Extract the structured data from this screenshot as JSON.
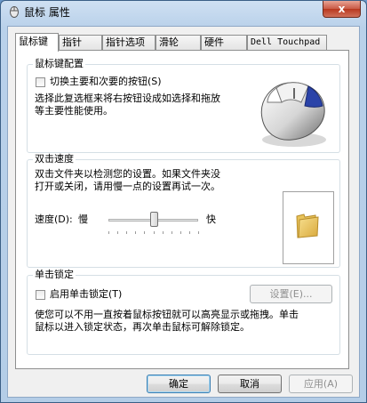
{
  "window": {
    "title": "鼠标 属性",
    "close_label": "x"
  },
  "tabs": [
    {
      "label": "鼠标键"
    },
    {
      "label": "指针"
    },
    {
      "label": "指针选项"
    },
    {
      "label": "滑轮"
    },
    {
      "label": "硬件"
    },
    {
      "label": "Dell Touchpad"
    }
  ],
  "button_config": {
    "group_label": "鼠标键配置",
    "checkbox_label": "切换主要和次要的按钮(S)",
    "checked": false,
    "description_line1": "选择此复选框来将右按钮设成如选择和拖放",
    "description_line2": "等主要性能使用。"
  },
  "double_click": {
    "group_label": "双击速度",
    "description_line1": "双击文件夹以检测您的设置。如果文件夹没",
    "description_line2": "打开或关闭，请用慢一点的设置再试一次。",
    "speed_label": "速度(D):",
    "slow_label": "慢",
    "fast_label": "快",
    "speed_level": 0.5
  },
  "click_lock": {
    "group_label": "单击锁定",
    "checkbox_label": "启用单击锁定(T)",
    "checked": false,
    "settings_button": "设置(E)...",
    "description_line1": "使您可以不用一直按着鼠标按钮就可以高亮显示或拖拽。单击",
    "description_line2": "鼠标以进入锁定状态，再次单击鼠标可解除锁定。"
  },
  "footer": {
    "ok_label": "确定",
    "cancel_label": "取消",
    "apply_label": "应用(A)"
  },
  "icons": [
    "mouse-properties-icon",
    "mouse-image-icon",
    "folder-icon"
  ],
  "colors": {
    "title_bar": "#b9d1ea",
    "close_button": "#c95a45",
    "folder": "#e8c35a"
  }
}
